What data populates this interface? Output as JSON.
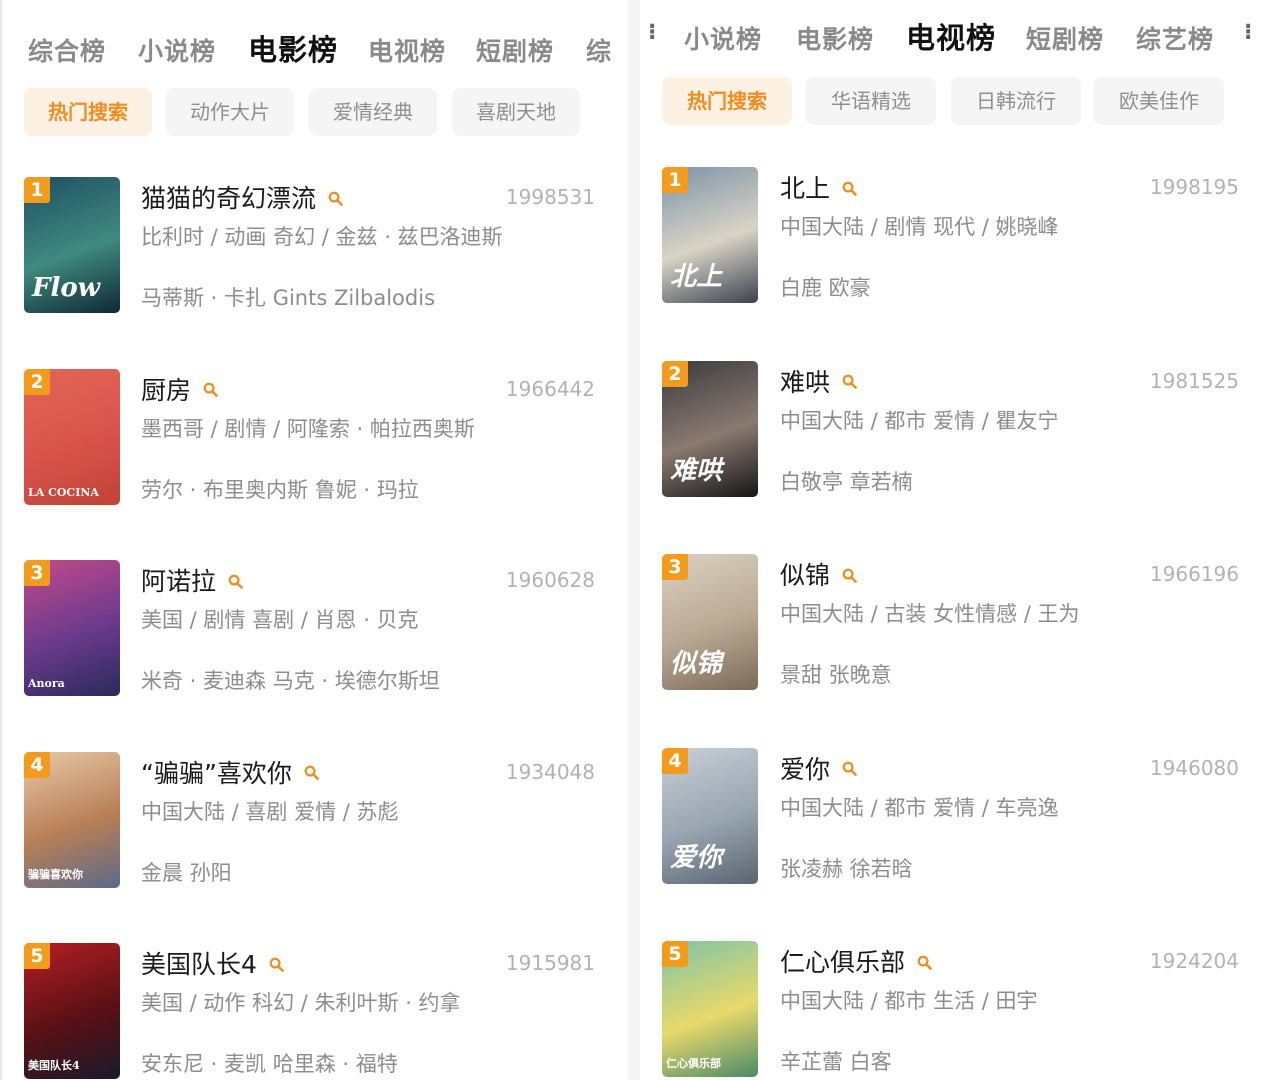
{
  "left": {
    "tabs": [
      "综合榜",
      "小说榜",
      "电影榜",
      "电视榜",
      "短剧榜",
      "综"
    ],
    "active_tab": "电影榜",
    "chips": [
      "热门搜索",
      "动作大片",
      "爱情经典",
      "喜剧天地"
    ],
    "items": [
      {
        "rank": "1",
        "title": "猫猫的奇幻漂流",
        "score": "1998531",
        "meta": "比利时 / 动画 奇幻 / 金兹 · 兹巴洛迪斯",
        "cast": "马蒂斯 · 卡扎 Gints Zilbalodis",
        "poster_text": "Flow",
        "poster_colors": [
          "#1f4f64",
          "#3f8a7e",
          "#0f2836"
        ]
      },
      {
        "rank": "2",
        "title": "厨房",
        "score": "1966442",
        "meta": "墨西哥 / 剧情 / 阿隆索 · 帕拉西奥斯",
        "cast": "劳尔 · 布里奥内斯 鲁妮 · 玛拉",
        "poster_text": "LA COCINA",
        "poster_colors": [
          "#e36658",
          "#d8544a",
          "#c14236"
        ]
      },
      {
        "rank": "3",
        "title": "阿诺拉",
        "score": "1960628",
        "meta": "美国 / 剧情 喜剧 / 肖恩 · 贝克",
        "cast": "米奇 · 麦迪森 马克 · 埃德尔斯坦",
        "poster_text": "Anora",
        "poster_colors": [
          "#c44a8a",
          "#6a3a8c",
          "#2a2a5a"
        ]
      },
      {
        "rank": "4",
        "title": "“骗骗”喜欢你",
        "score": "1934048",
        "meta": "中国大陆 / 喜剧 爱情 / 苏彪",
        "cast": "金晨 孙阳",
        "poster_text": "骗骗喜欢你",
        "poster_colors": [
          "#e8c9a8",
          "#b87f56",
          "#5a6a8a"
        ]
      },
      {
        "rank": "5",
        "title": "美国队长4",
        "score": "1915981",
        "meta": "美国 / 动作 科幻 / 朱利叶斯 · 约拿",
        "cast": "安东尼 · 麦凯 哈里森 · 福特",
        "poster_text": "美国队长4",
        "poster_colors": [
          "#b51f24",
          "#5a1015",
          "#1a1a2a"
        ]
      }
    ]
  },
  "right": {
    "tabs": [
      "小说榜",
      "电影榜",
      "电视榜",
      "短剧榜",
      "综艺榜"
    ],
    "active_tab": "电视榜",
    "chips": [
      "热门搜索",
      "华语精选",
      "日韩流行",
      "欧美佳作"
    ],
    "items": [
      {
        "rank": "1",
        "title": "北上",
        "score": "1998195",
        "meta": "中国大陆 / 剧情 现代 / 姚晓峰",
        "cast": "白鹿 欧豪",
        "poster_text": "北上",
        "poster_colors": [
          "#7c93a8",
          "#d9d4c6",
          "#3a4250"
        ]
      },
      {
        "rank": "2",
        "title": "难哄",
        "score": "1981525",
        "meta": "中国大陆 / 都市 爱情 / 瞿友宁",
        "cast": "白敬亭 章若楠",
        "poster_text": "难哄",
        "poster_colors": [
          "#3a3a3e",
          "#8a7a70",
          "#151518"
        ]
      },
      {
        "rank": "3",
        "title": "似锦",
        "score": "1966196",
        "meta": "中国大陆 / 古装 女性情感 / 王为",
        "cast": "景甜 张晚意",
        "poster_text": "似锦",
        "poster_colors": [
          "#dcd2c3",
          "#b8a893",
          "#7a6a58"
        ]
      },
      {
        "rank": "4",
        "title": "爱你",
        "score": "1946080",
        "meta": "中国大陆 / 都市 爱情 / 车亮逸",
        "cast": "张凌赫 徐若晗",
        "poster_text": "爱你",
        "poster_colors": [
          "#c9d0d8",
          "#98a4b0",
          "#5a6470"
        ]
      },
      {
        "rank": "5",
        "title": "仁心俱乐部",
        "score": "1924204",
        "meta": "中国大陆 / 都市 生活 / 田宇",
        "cast": "辛芷蕾 白客",
        "poster_text": "仁心俱乐部",
        "poster_colors": [
          "#7ec4a8",
          "#e8d96a",
          "#4a8a6a"
        ]
      }
    ]
  },
  "icons": {
    "search": "search-icon"
  },
  "colors": {
    "accent": "#f28c1e",
    "rank_badge": "#f29b1d",
    "chip_active_bg": "#fdf1e3"
  }
}
